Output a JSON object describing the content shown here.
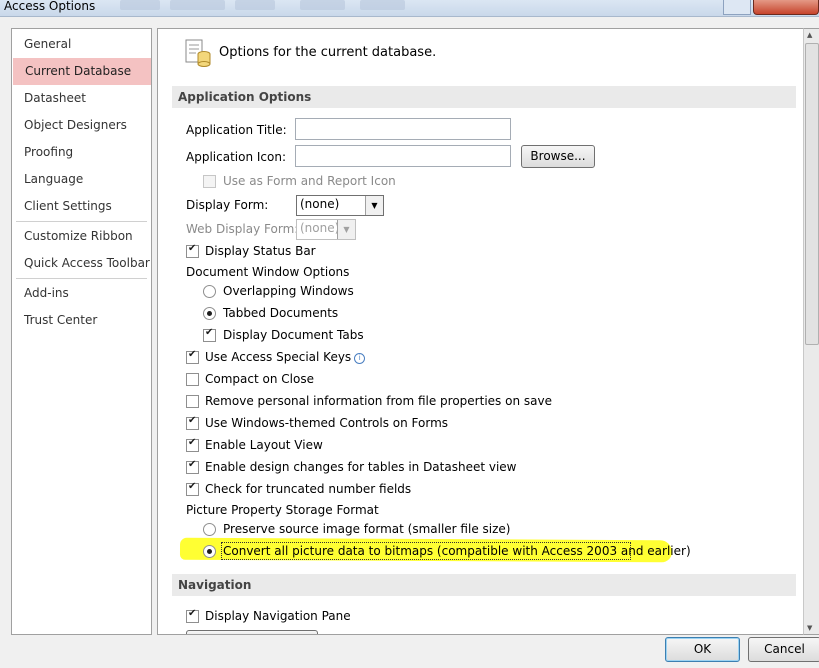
{
  "window": {
    "title": "Access Options"
  },
  "nav": {
    "items": [
      {
        "label": "General"
      },
      {
        "label": "Current Database"
      },
      {
        "label": "Datasheet"
      },
      {
        "label": "Object Designers"
      },
      {
        "label": "Proofing"
      },
      {
        "label": "Language"
      },
      {
        "label": "Client Settings"
      },
      {
        "label": "Customize Ribbon"
      },
      {
        "label": "Quick Access Toolbar"
      },
      {
        "label": "Add-ins"
      },
      {
        "label": "Trust Center"
      }
    ]
  },
  "header": {
    "title": "Options for the current database."
  },
  "app_options": {
    "section": "Application Options",
    "app_title_label": "Application Title:",
    "app_title_value": "",
    "app_icon_label": "Application Icon:",
    "app_icon_value": "",
    "browse_label": "Browse...",
    "use_as_icon_label": "Use as Form and Report Icon",
    "display_form_label": "Display Form:",
    "display_form_value": "(none)",
    "web_display_form_label": "Web Display Form:",
    "web_display_form_value": "(none)",
    "display_status_bar": "Display Status Bar",
    "doc_window_options": "Document Window Options",
    "overlapping_windows": "Overlapping Windows",
    "tabbed_documents": "Tabbed Documents",
    "display_document_tabs": "Display Document Tabs",
    "use_access_special_keys": "Use Access Special Keys",
    "compact_on_close": "Compact on Close",
    "remove_personal_info": "Remove personal information from file properties on save",
    "windows_themed_controls": "Use Windows-themed Controls on Forms",
    "enable_layout_view": "Enable Layout View",
    "enable_design_changes": "Enable design changes for tables in Datasheet view",
    "check_truncated": "Check for truncated number fields",
    "picture_storage": "Picture Property Storage Format",
    "preserve_source": "Preserve source image format (smaller file size)",
    "convert_bitmaps": "Convert all picture data to bitmaps (compatible with Access 2003 and earlier)"
  },
  "navigation": {
    "section": "Navigation",
    "display_nav_pane": "Display Navigation Pane"
  },
  "footer": {
    "ok": "OK",
    "cancel": "Cancel"
  },
  "colors": {
    "highlight": "#ffff33",
    "nav_active": "#f4c2c2"
  }
}
